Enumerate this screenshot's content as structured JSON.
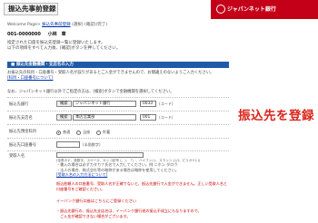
{
  "header": {
    "title": "振込先事前登録",
    "bank_name": "ジャパンネット銀行"
  },
  "breadcrumb": {
    "prefix": "Welcome Page>",
    "link": "振込先事前登録",
    "current": "(選択)",
    "suffix": "(確認)(完了)"
  },
  "user": {
    "account": "001-0000000",
    "name": "小林　章"
  },
  "intro": {
    "line1": "指定された口座を振込先登録一覧に登録いたします。",
    "line2": "以下の項目をすべて入力後、[確認]ボタンを押してください。"
  },
  "section1": {
    "heading": "■ 振込先金融機関・支店名の入力"
  },
  "notes": {
    "line1": "お振込先の科目・口座番号・受取人名が誤りがあるとご入金ができませんので、お間違えのないようご入力ください。",
    "link": "[科目・口座番号について]",
    "line2": "なお、ジャパンネット銀行以外でご指定の方は、[検索]ボタンで金融機関を選択してください。"
  },
  "form": {
    "bank_label": "振込先銀行",
    "search_button": "検索",
    "bank_value": "ジャパンネット銀行",
    "bank_code": "0033",
    "code_hint": "(コード)",
    "branch_label": "振込先支店名",
    "branch_value": "本店営業部",
    "branch_code": "001",
    "type_label": "振込先預金科目",
    "type_options": [
      "普通",
      "当座",
      "貯蓄"
    ],
    "account_label": "振込先口座番号",
    "account_hint": "(半角数字)",
    "recipient_label": "受取人名",
    "recipient_hint": "(全角カナ、英数字、スペース、カッコ記号 (、)、「」、ハイフン(-)、スラッシュ(/)、ピリオド(.))"
  },
  "small_notes": {
    "line1": "・書入の場合は必ずカタカナ氏名で入力してください。例:ニホン タロウ",
    "line2": "・法人の場合、株式会社等の略称がある場合は略称を使用してください。",
    "link": "[受取人名の入力方法について]"
  },
  "warning": {
    "text": "振込依頼人の口座番号、受取人名が正確でないと、振込先銀行で入金ができません。正しい受取人名と口座番号をご確認ください。",
    "link_line": "イーバンク銀行口座はこちらにご登録ください",
    "bullet1": "・振込先銀行の、振込先支店名は、イーバンク銀行宛の振込不成立にもなりますので。",
    "bullet2": "　ご入金が確認できない場合がございます。"
  },
  "overlay": {
    "label": "振込先を登録"
  }
}
